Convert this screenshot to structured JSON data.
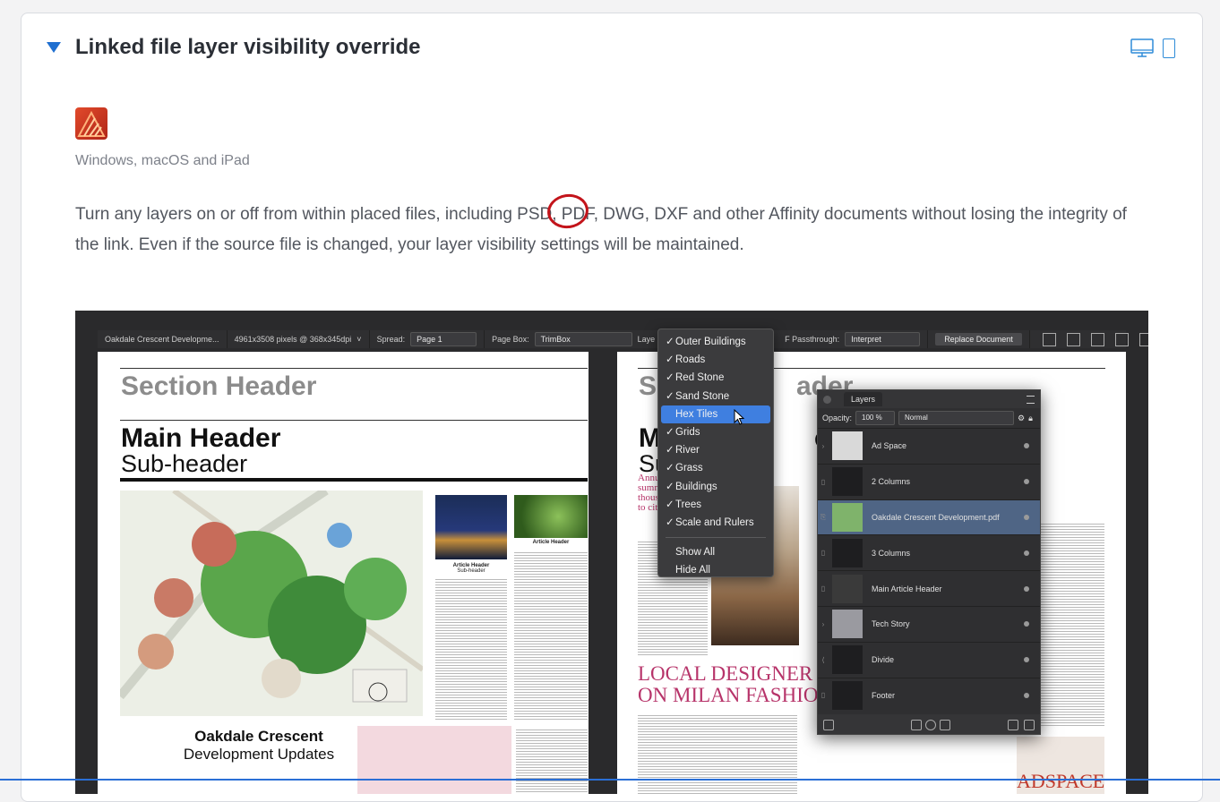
{
  "section": {
    "title": "Linked file layer visibility override",
    "platforms": "Windows, macOS and iPad",
    "description": "Turn any layers on or off from within placed files, including PSD, PDF, DWG, DXF and other Affinity documents without losing the integrity of the link. Even if the source file is changed, your layer visibility settings will be maintained."
  },
  "colors": {
    "accent": "#1f6fd0",
    "annotation": "#c3141b",
    "highlight": "#3f7fe0"
  },
  "toolbar": {
    "document": "Oakdale Crescent Developme...",
    "resolution": "4961x3508 pixels @ 368x345dpi",
    "spread_label": "Spread:",
    "spread_value": "Page 1",
    "pagebox_label": "Page Box:",
    "pagebox_value": "TrimBox",
    "layers_label": "Laye",
    "passthrough_label": "F Passthrough:",
    "passthrough_value": "Interpret",
    "replace_button": "Replace Document"
  },
  "doc": {
    "section_header": "Section Header",
    "section_header_right": "Se",
    "section_header_right2": "ader",
    "main_header": "Main Header",
    "main_header_right": "M",
    "main_header_right2": "er",
    "sub_header": "Sub-header",
    "sub_header_right": "Su",
    "article_header": "Article Header",
    "article_subheader": "Sub-header",
    "article_header2": "Article Header",
    "oakdale_1": "Oakdale Crescent",
    "oakdale_2": "Development Updates",
    "local_1": "LOCAL DESIGNER",
    "local_2": "ON MILAN FASHIO",
    "annual_1": "Annu",
    "annual_2": "summ",
    "annual_3": "thous",
    "annual_4": "to city",
    "adspace": "ADSPACE"
  },
  "layer_menu": {
    "items": [
      {
        "label": "Outer Buildings",
        "check": "✓"
      },
      {
        "label": "Roads",
        "check": "✓"
      },
      {
        "label": "Red Stone",
        "check": "✓"
      },
      {
        "label": "Sand Stone",
        "check": "✓"
      },
      {
        "label": "Hex Tiles",
        "check": ""
      },
      {
        "label": "Grids",
        "check": "✓"
      },
      {
        "label": "River",
        "check": "✓"
      },
      {
        "label": "Grass",
        "check": "✓"
      },
      {
        "label": "Buildings",
        "check": "✓"
      },
      {
        "label": "Trees",
        "check": "✓"
      },
      {
        "label": "Scale and Rulers",
        "check": "✓"
      }
    ],
    "show_all": "Show All",
    "hide_all": "Hide All"
  },
  "layers_panel": {
    "tab": "Layers",
    "opacity_label": "Opacity:",
    "opacity_value": "100 %",
    "blend_mode": "Normal",
    "rows": [
      {
        "name": "Ad Space"
      },
      {
        "name": "2 Columns"
      },
      {
        "name": "Oakdale Crescent Development.pdf"
      },
      {
        "name": "3 Columns"
      },
      {
        "name": "Main Article Header"
      },
      {
        "name": "Tech Story"
      },
      {
        "name": "Divide"
      },
      {
        "name": "Footer"
      }
    ]
  }
}
